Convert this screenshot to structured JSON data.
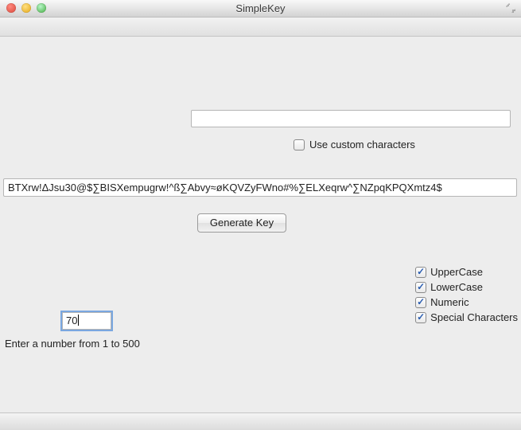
{
  "window": {
    "title": "SimpleKey"
  },
  "custom": {
    "value": "",
    "use_custom_label": "Use custom characters",
    "use_custom_checked": false
  },
  "output": {
    "value": "BTXrw!ΔJsu30@$∑BISXempugrw!^ß∑Abvy≈øKQVZyFWno#%∑ELXeqrw^∑NZpqKPQXmtz4$"
  },
  "generate": {
    "label": "Generate Key"
  },
  "length": {
    "value": "70",
    "hint": "Enter a number from 1 to 500"
  },
  "options": {
    "upper": {
      "label": "UpperCase",
      "checked": true
    },
    "lower": {
      "label": "LowerCase",
      "checked": true
    },
    "numeric": {
      "label": "Numeric",
      "checked": true
    },
    "special": {
      "label": "Special Characters",
      "checked": true
    }
  }
}
